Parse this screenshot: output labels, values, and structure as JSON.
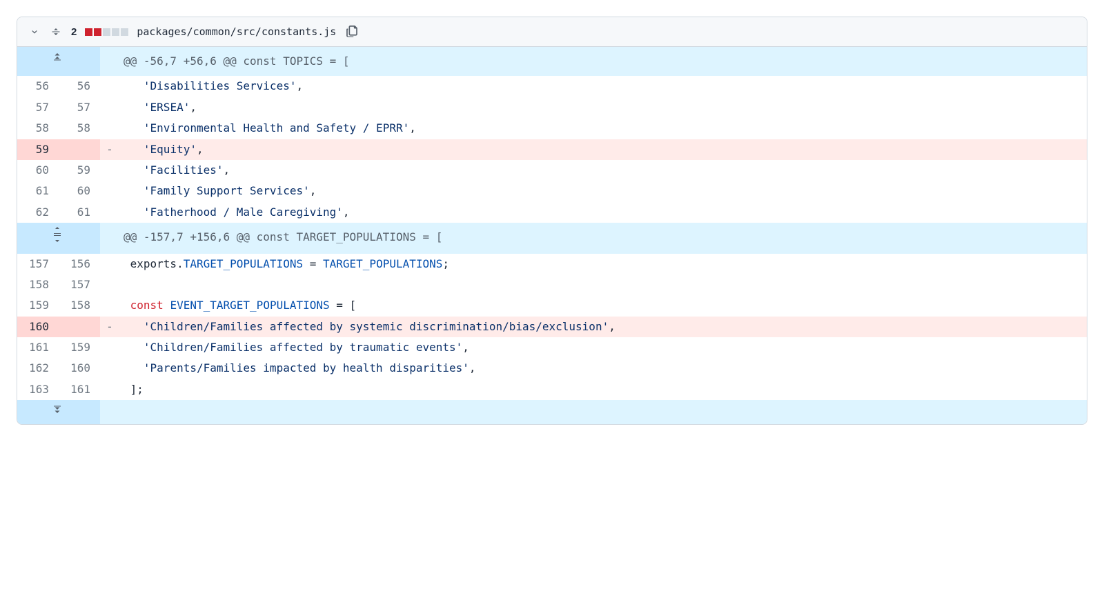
{
  "file_header": {
    "change_count": "2",
    "path": "packages/common/src/constants.js",
    "diffstat": {
      "deletions": 2,
      "neutral": 3
    }
  },
  "hunks": [
    {
      "header": "@@ -56,7 +56,6 @@ const TOPICS = [",
      "expand_mode": "up",
      "lines": [
        {
          "type": "ctx",
          "old": "56",
          "new": "56",
          "segments": [
            {
              "t": "plain",
              "v": "   "
            },
            {
              "t": "str",
              "v": "'Disabilities Services'"
            },
            {
              "t": "plain",
              "v": ","
            }
          ]
        },
        {
          "type": "ctx",
          "old": "57",
          "new": "57",
          "segments": [
            {
              "t": "plain",
              "v": "   "
            },
            {
              "t": "str",
              "v": "'ERSEA'"
            },
            {
              "t": "plain",
              "v": ","
            }
          ]
        },
        {
          "type": "ctx",
          "old": "58",
          "new": "58",
          "segments": [
            {
              "t": "plain",
              "v": "   "
            },
            {
              "t": "str",
              "v": "'Environmental Health and Safety / EPRR'"
            },
            {
              "t": "plain",
              "v": ","
            }
          ]
        },
        {
          "type": "del",
          "old": "59",
          "new": "",
          "segments": [
            {
              "t": "plain",
              "v": "   "
            },
            {
              "t": "str",
              "v": "'Equity'"
            },
            {
              "t": "plain",
              "v": ","
            }
          ]
        },
        {
          "type": "ctx",
          "old": "60",
          "new": "59",
          "segments": [
            {
              "t": "plain",
              "v": "   "
            },
            {
              "t": "str",
              "v": "'Facilities'"
            },
            {
              "t": "plain",
              "v": ","
            }
          ]
        },
        {
          "type": "ctx",
          "old": "61",
          "new": "60",
          "segments": [
            {
              "t": "plain",
              "v": "   "
            },
            {
              "t": "str",
              "v": "'Family Support Services'"
            },
            {
              "t": "plain",
              "v": ","
            }
          ]
        },
        {
          "type": "ctx",
          "old": "62",
          "new": "61",
          "segments": [
            {
              "t": "plain",
              "v": "   "
            },
            {
              "t": "str",
              "v": "'Fatherhood / Male Caregiving'"
            },
            {
              "t": "plain",
              "v": ","
            }
          ]
        }
      ]
    },
    {
      "header": "@@ -157,7 +156,6 @@ const TARGET_POPULATIONS = [",
      "expand_mode": "both",
      "lines": [
        {
          "type": "ctx",
          "old": "157",
          "new": "156",
          "segments": [
            {
              "t": "plain",
              "v": " exports."
            },
            {
              "t": "var",
              "v": "TARGET_POPULATIONS"
            },
            {
              "t": "plain",
              "v": " = "
            },
            {
              "t": "var",
              "v": "TARGET_POPULATIONS"
            },
            {
              "t": "plain",
              "v": ";"
            }
          ]
        },
        {
          "type": "ctx",
          "old": "158",
          "new": "157",
          "segments": [
            {
              "t": "plain",
              "v": ""
            }
          ]
        },
        {
          "type": "ctx",
          "old": "159",
          "new": "158",
          "segments": [
            {
              "t": "plain",
              "v": " "
            },
            {
              "t": "kw",
              "v": "const"
            },
            {
              "t": "plain",
              "v": " "
            },
            {
              "t": "var",
              "v": "EVENT_TARGET_POPULATIONS"
            },
            {
              "t": "plain",
              "v": " = ["
            }
          ]
        },
        {
          "type": "del",
          "old": "160",
          "new": "",
          "segments": [
            {
              "t": "plain",
              "v": "   "
            },
            {
              "t": "str",
              "v": "'Children/Families affected by systemic discrimination/bias/exclusion'"
            },
            {
              "t": "plain",
              "v": ","
            }
          ]
        },
        {
          "type": "ctx",
          "old": "161",
          "new": "159",
          "segments": [
            {
              "t": "plain",
              "v": "   "
            },
            {
              "t": "str",
              "v": "'Children/Families affected by traumatic events'"
            },
            {
              "t": "plain",
              "v": ","
            }
          ]
        },
        {
          "type": "ctx",
          "old": "162",
          "new": "160",
          "segments": [
            {
              "t": "plain",
              "v": "   "
            },
            {
              "t": "str",
              "v": "'Parents/Families impacted by health disparities'"
            },
            {
              "t": "plain",
              "v": ","
            }
          ]
        },
        {
          "type": "ctx",
          "old": "163",
          "new": "161",
          "segments": [
            {
              "t": "plain",
              "v": " ];"
            }
          ]
        }
      ]
    }
  ],
  "trailing_expand": true
}
